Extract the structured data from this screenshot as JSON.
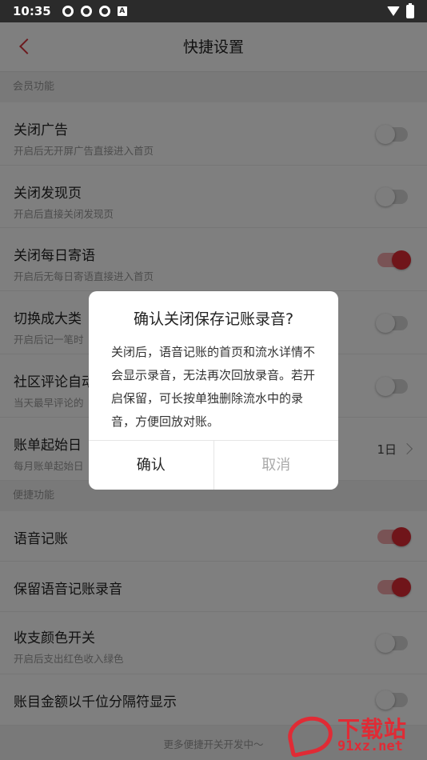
{
  "status_bar": {
    "time": "10:35",
    "notification_icons": [
      "sync-ring-icon",
      "sync-ring-icon",
      "sync-ring-icon",
      "a-badge-icon"
    ],
    "a_badge": "A"
  },
  "nav": {
    "title": "快捷设置"
  },
  "sections": {
    "member": "会员功能",
    "quick": "便捷功能"
  },
  "settings": {
    "close_ads": {
      "title": "关闭广告",
      "sub": "开启后无开屏广告直接进入首页",
      "on": false
    },
    "close_discover": {
      "title": "关闭发现页",
      "sub": "开启后直接关闭发现页",
      "on": false
    },
    "close_daily": {
      "title": "关闭每日寄语",
      "sub": "开启后无每日寄语直接进入首页",
      "on": true
    },
    "big_category": {
      "title": "切换成大类",
      "sub": "开启后记一笔时",
      "on": false
    },
    "community": {
      "title": "社区评论自动",
      "sub": "当天最早评论的",
      "on": false
    },
    "bill_start": {
      "title": "账单起始日",
      "sub": "每月账单起始日",
      "value": "1日"
    },
    "voice_bill": {
      "title": "语音记账",
      "on": true
    },
    "keep_recording": {
      "title": "保留语音记账录音",
      "on": true
    },
    "color_switch": {
      "title": "收支颜色开关",
      "sub": "开启后支出红色收入绿色",
      "on": false
    },
    "thousands": {
      "title": "账目金额以千位分隔符显示",
      "on": false
    }
  },
  "footer": "更多便捷开关开发中～",
  "dialog": {
    "title": "确认关闭保存记账录音?",
    "body": "关闭后，语音记账的首页和流水详情不会显示录音，无法再次回放录音。若开启保留，可长按单独删除流水中的录音，方便回放对账。",
    "confirm": "确认",
    "cancel": "取消"
  },
  "watermark": {
    "text1": "下载站",
    "text2": "91xz.net"
  },
  "colors": {
    "accent": "#e02b35",
    "toggle_on_track": "#f3a7ab",
    "toggle_off_track": "#d8d8d8"
  }
}
